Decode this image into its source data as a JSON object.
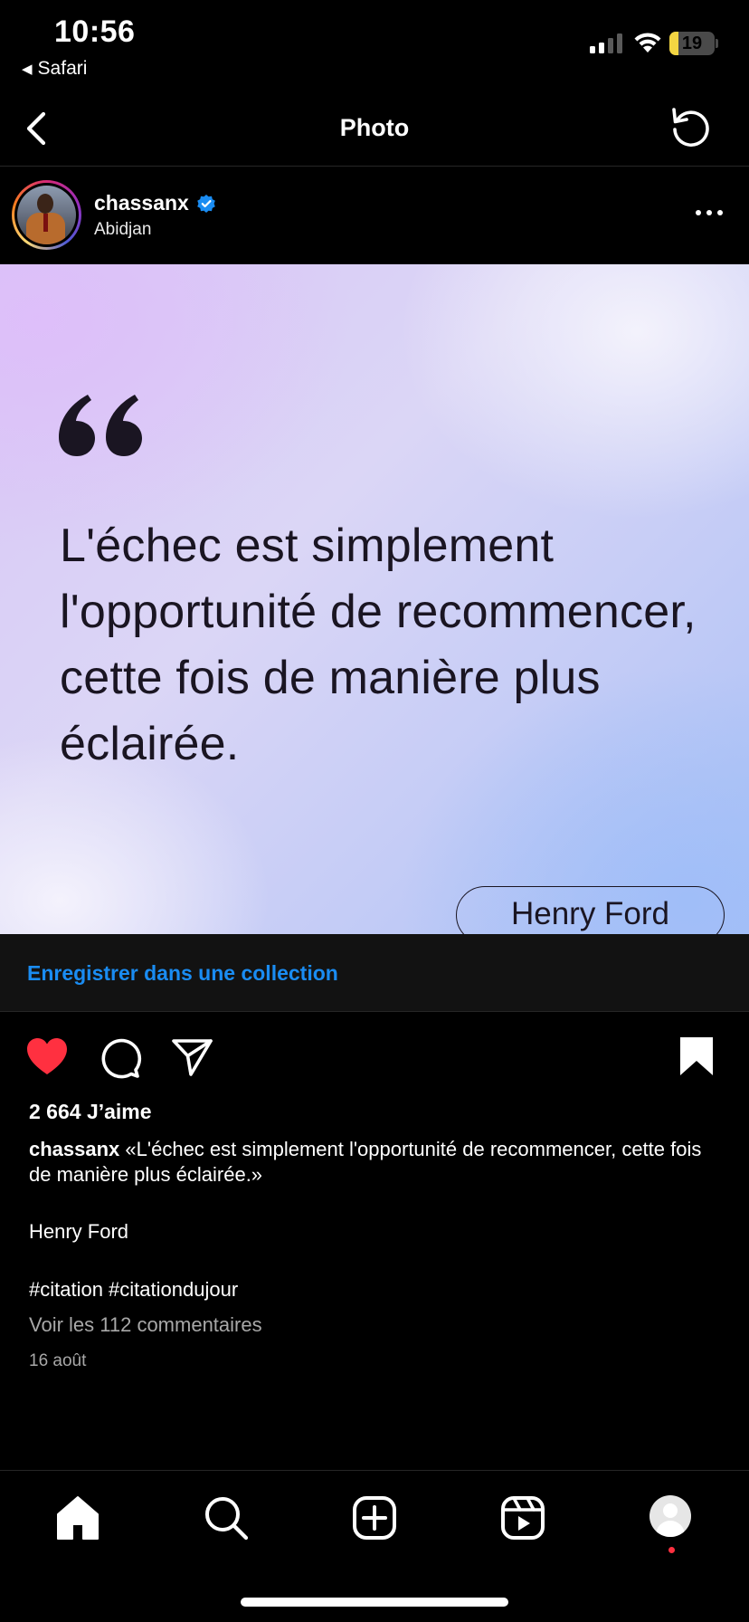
{
  "status_bar": {
    "time": "10:56",
    "back_app": "Safari",
    "battery_level": "19",
    "battery_fraction": 0.19,
    "battery_color": "#f3d542"
  },
  "nav": {
    "back_icon": "chevron-left-icon",
    "title": "Photo",
    "refresh_icon": "refresh-icon"
  },
  "post": {
    "username": "chassanx",
    "verified": true,
    "location": "Abidjan",
    "more_icon": "more-horizontal-icon",
    "image": {
      "quote": "L'échec est simplement l'opportunité de recommencer, cette fois de manière plus éclairée.",
      "author": "Henry Ford"
    },
    "save_collection_label": "Enregistrer dans une collection",
    "actions": {
      "like_icon": "heart-filled-icon",
      "comment_icon": "comment-icon",
      "share_icon": "send-icon",
      "save_icon": "bookmark-filled-icon",
      "liked": true,
      "saved": true
    },
    "likes": "2 664 J’aime",
    "caption_user": "chassanx",
    "caption_text": "«L'échec est simplement l'opportunité de recommencer, cette fois de manière plus éclairée.»",
    "caption_author": "Henry Ford",
    "hashtags": "#citation #citationdujour",
    "comments_link": "Voir les 112 commentaires",
    "date": "16 août"
  },
  "tab_bar": {
    "items": [
      "home-icon",
      "search-icon",
      "create-post-icon",
      "reels-icon",
      "profile-avatar"
    ],
    "active": "profile-avatar",
    "has_notification": true
  },
  "colors": {
    "accent_link": "#1a8cf2",
    "like_red": "#ff3040",
    "background": "#000000"
  }
}
